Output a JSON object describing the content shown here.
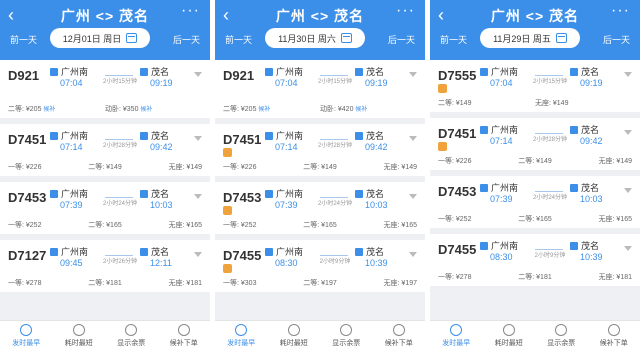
{
  "phones": [
    {
      "title": "广州 <> 茂名",
      "prev": "前一天",
      "next": "后一天",
      "date": "12月01日 周日",
      "trains": [
        {
          "num": "D921",
          "tag": false,
          "from": "广州南",
          "to": "茂名",
          "dep": "07:04",
          "arr": "09:19",
          "dur": "2小时15分钟",
          "f1": "二等: ¥205",
          "f1b": "候补",
          "f2": "动卧: ¥350",
          "f2b": "候补",
          "f3": ""
        },
        {
          "num": "D7451",
          "tag": false,
          "from": "广州南",
          "to": "茂名",
          "dep": "07:14",
          "arr": "09:42",
          "dur": "2小时28分钟",
          "f1": "一等: ¥226",
          "f1b": "",
          "f2": "二等: ¥149",
          "f2b": "",
          "f3": "无座: ¥149"
        },
        {
          "num": "D7453",
          "tag": false,
          "from": "广州南",
          "to": "茂名",
          "dep": "07:39",
          "arr": "10:03",
          "dur": "2小时24分钟",
          "f1": "一等: ¥252",
          "f1b": "",
          "f2": "二等: ¥165",
          "f2b": "",
          "f3": "无座: ¥165"
        },
        {
          "num": "D7127",
          "tag": false,
          "from": "广州南",
          "to": "茂名",
          "dep": "09:45",
          "arr": "12:11",
          "dur": "2小时26分钟",
          "f1": "一等: ¥278",
          "f1b": "",
          "f2": "二等: ¥181",
          "f2b": "",
          "f3": "无座: ¥181"
        }
      ],
      "tabs": [
        "发时最早",
        "耗时最短",
        "显示余票",
        "候补下单"
      ]
    },
    {
      "title": "广州 <> 茂名",
      "prev": "前一天",
      "next": "后一天",
      "date": "11月30日 周六",
      "trains": [
        {
          "num": "D921",
          "tag": false,
          "from": "广州南",
          "to": "茂名",
          "dep": "07:04",
          "arr": "09:19",
          "dur": "2小时15分钟",
          "f1": "二等: ¥205",
          "f1b": "候补",
          "f2": "动卧: ¥420",
          "f2b": "候补",
          "f3": ""
        },
        {
          "num": "D7451",
          "tag": true,
          "from": "广州南",
          "to": "茂名",
          "dep": "07:14",
          "arr": "09:42",
          "dur": "2小时28分钟",
          "f1": "一等: ¥226",
          "f1b": "",
          "f2": "二等: ¥149",
          "f2b": "",
          "f3": "无座: ¥149"
        },
        {
          "num": "D7453",
          "tag": true,
          "from": "广州南",
          "to": "茂名",
          "dep": "07:39",
          "arr": "10:03",
          "dur": "2小时24分钟",
          "f1": "一等: ¥252",
          "f1b": "",
          "f2": "二等: ¥165",
          "f2b": "",
          "f3": "无座: ¥165"
        },
        {
          "num": "D7455",
          "tag": true,
          "from": "广州南",
          "to": "茂名",
          "dep": "08:30",
          "arr": "10:39",
          "dur": "2小时9分钟",
          "f1": "一等: ¥303",
          "f1b": "",
          "f2": "二等: ¥197",
          "f2b": "",
          "f3": "无座: ¥197"
        }
      ],
      "tabs": [
        "发时最早",
        "耗时最短",
        "显示余票",
        "候补下单"
      ]
    },
    {
      "title": "广州 <> 茂名",
      "prev": "前一天",
      "next": "后一天",
      "date": "11月29日 周五",
      "trains": [
        {
          "num": "D7555",
          "tag": true,
          "from": "广州南",
          "to": "茂名",
          "dep": "07:04",
          "arr": "09:19",
          "dur": "2小时15分钟",
          "f1": "二等: ¥149",
          "f1b": "",
          "f2": "无座: ¥149",
          "f2b": "",
          "f3": ""
        },
        {
          "num": "D7451",
          "tag": true,
          "from": "广州南",
          "to": "茂名",
          "dep": "07:14",
          "arr": "09:42",
          "dur": "2小时28分钟",
          "f1": "一等: ¥226",
          "f1b": "",
          "f2": "二等: ¥149",
          "f2b": "",
          "f3": "无座: ¥149"
        },
        {
          "num": "D7453",
          "tag": false,
          "from": "广州南",
          "to": "茂名",
          "dep": "07:39",
          "arr": "10:03",
          "dur": "2小时24分钟",
          "f1": "一等: ¥252",
          "f1b": "",
          "f2": "二等: ¥165",
          "f2b": "",
          "f3": "无座: ¥165"
        },
        {
          "num": "D7455",
          "tag": false,
          "from": "广州南",
          "to": "茂名",
          "dep": "08:30",
          "arr": "10:39",
          "dur": "2小时9分钟",
          "f1": "一等: ¥278",
          "f1b": "",
          "f2": "二等: ¥181",
          "f2b": "",
          "f3": "无座: ¥181"
        }
      ],
      "tabs": [
        "发时最早",
        "耗时最短",
        "显示余票",
        "候补下单"
      ]
    }
  ]
}
